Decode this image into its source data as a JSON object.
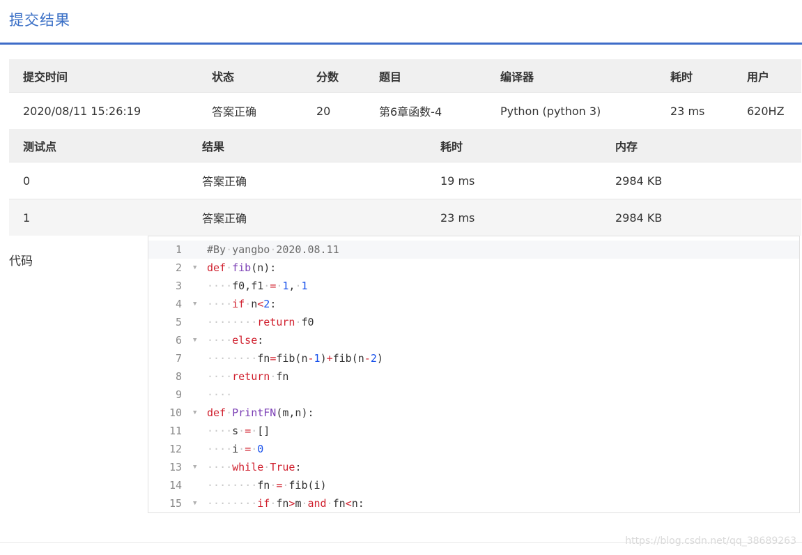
{
  "page": {
    "title": "提交结果",
    "accent_color": "#3e6cc8"
  },
  "submission": {
    "headers": [
      "提交时间",
      "状态",
      "分数",
      "题目",
      "编译器",
      "耗时",
      "用户"
    ],
    "row": {
      "time": "2020/08/11 15:26:19",
      "status": "答案正确",
      "score": "20",
      "problem": "第6章函数-4",
      "compiler": "Python (python 3)",
      "elapsed": "23 ms",
      "user": "620HZ"
    }
  },
  "testpoints": {
    "headers": [
      "测试点",
      "结果",
      "耗时",
      "内存"
    ],
    "rows": [
      {
        "id": "0",
        "result": "答案正确",
        "time": "19 ms",
        "memory": "2984 KB"
      },
      {
        "id": "1",
        "result": "答案正确",
        "time": "23 ms",
        "memory": "2984 KB"
      }
    ]
  },
  "code": {
    "label": "代码",
    "lines": [
      {
        "n": "1",
        "text": "#By yangbo 2020.08.11"
      },
      {
        "n": "2",
        "text": "def fib(n):"
      },
      {
        "n": "3",
        "text": "    f0,f1 = 1, 1"
      },
      {
        "n": "4",
        "text": "    if n<2:"
      },
      {
        "n": "5",
        "text": "        return f0"
      },
      {
        "n": "6",
        "text": "    else:"
      },
      {
        "n": "7",
        "text": "        fn=fib(n-1)+fib(n-2)"
      },
      {
        "n": "8",
        "text": "    return fn"
      },
      {
        "n": "9",
        "text": "    "
      },
      {
        "n": "10",
        "text": "def PrintFN(m,n):"
      },
      {
        "n": "11",
        "text": "    s = []"
      },
      {
        "n": "12",
        "text": "    i = 0"
      },
      {
        "n": "13",
        "text": "    while True:"
      },
      {
        "n": "14",
        "text": "        fn = fib(i)"
      },
      {
        "n": "15",
        "text": "        if fn>m and fn<n:"
      }
    ],
    "fold_lines": [
      "2",
      "4",
      "6",
      "10",
      "13",
      "15"
    ]
  },
  "watermark": "https://blog.csdn.net/qq_38689263",
  "colors": {
    "status_ok": "#e5353f",
    "link": "#2c5c9e",
    "header_bg": "#f0f0f0"
  }
}
